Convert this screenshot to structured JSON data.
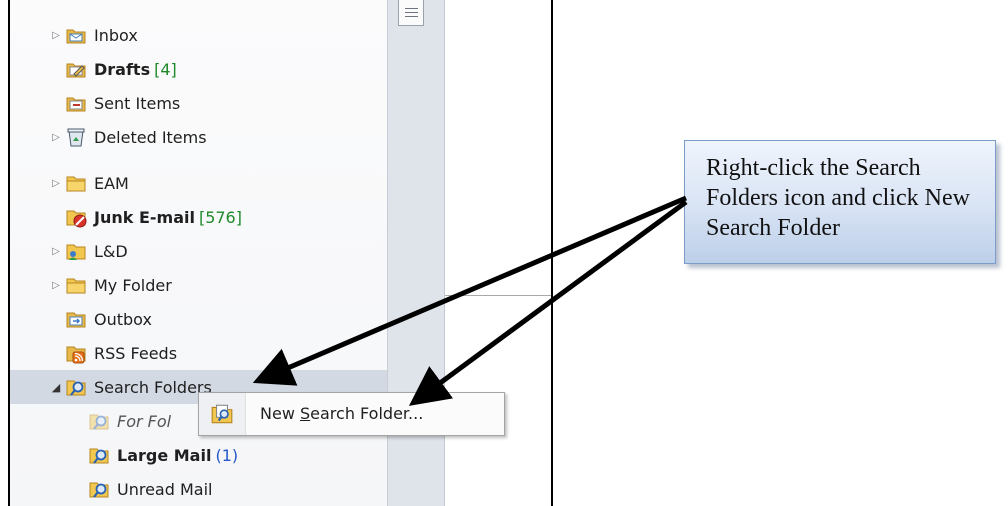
{
  "nav": {
    "folders": [
      {
        "label": "Inbox",
        "count": ""
      },
      {
        "label": "Drafts",
        "count": "[4]"
      },
      {
        "label": "Sent Items",
        "count": ""
      },
      {
        "label": "Deleted Items",
        "count": ""
      },
      {
        "label": "EAM",
        "count": ""
      },
      {
        "label": "Junk E-mail",
        "count": "[576]"
      },
      {
        "label": "L&D",
        "count": ""
      },
      {
        "label": "My Folder",
        "count": ""
      },
      {
        "label": "Outbox",
        "count": ""
      },
      {
        "label": "RSS Feeds",
        "count": ""
      },
      {
        "label": "Search Folders",
        "count": ""
      },
      {
        "label": "For Fol",
        "count": ""
      },
      {
        "label": "Large Mail",
        "count": "(1)"
      },
      {
        "label": "Unread Mail",
        "count": ""
      }
    ]
  },
  "context_menu": {
    "item_pre": "New ",
    "item_mnemonic": "S",
    "item_post": "earch Folder..."
  },
  "callout": {
    "text": "Right-click the Search Folders icon and click New Search Folder"
  },
  "colors": {
    "unread_count": "#1f8a2a",
    "large_mail_count": "#2358c9",
    "selection": "#d2d9e3",
    "callout_fill": "#d8e3f4"
  }
}
